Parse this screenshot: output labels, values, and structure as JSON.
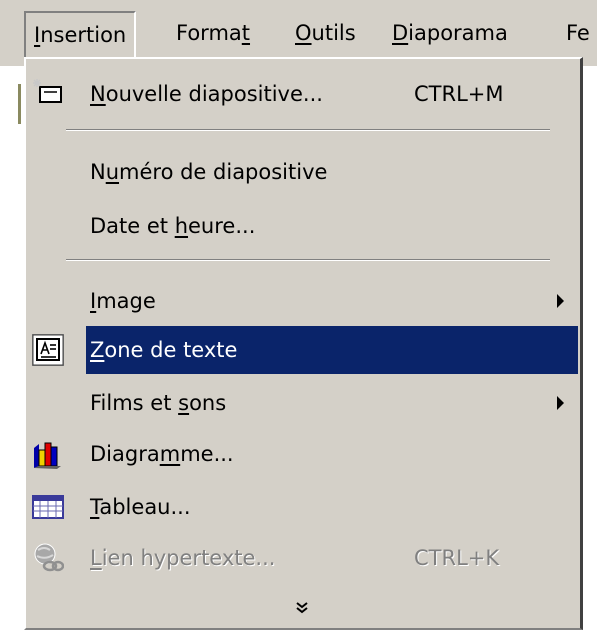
{
  "menubar": {
    "items": [
      {
        "pre": "",
        "u": "I",
        "post": "nsertion"
      },
      {
        "pre": "Forma",
        "u": "t",
        "post": ""
      },
      {
        "pre": "",
        "u": "O",
        "post": "utils"
      },
      {
        "pre": "",
        "u": "D",
        "post": "iaporama"
      },
      {
        "pre": "Fe",
        "u": "",
        "post": ""
      }
    ]
  },
  "menu": {
    "items": [
      {
        "pre": "",
        "u": "N",
        "post": "ouvelle diapositive...",
        "shortcut": "CTRL+M",
        "icon": "new-slide-icon"
      },
      {
        "pre": "N",
        "u": "u",
        "post": "méro de diapositive",
        "shortcut": ""
      },
      {
        "pre": "Date et ",
        "u": "h",
        "post": "eure...",
        "shortcut": ""
      },
      {
        "pre": "",
        "u": "I",
        "post": "mage",
        "submenu": true
      },
      {
        "pre": "",
        "u": "Z",
        "post": "one de texte",
        "icon": "text-box-icon",
        "highlighted": true
      },
      {
        "pre": "Films et ",
        "u": "s",
        "post": "ons",
        "submenu": true
      },
      {
        "pre": "Diagra",
        "u": "m",
        "post": "me...",
        "icon": "chart-icon"
      },
      {
        "pre": "",
        "u": "T",
        "post": "ableau...",
        "icon": "table-icon"
      },
      {
        "pre": "",
        "u": "L",
        "post": "ien hypertexte...",
        "shortcut": "CTRL+K",
        "icon": "hyperlink-icon",
        "disabled": true
      }
    ],
    "expand_glyph": "⌵",
    "highlight_color": "#0a246a",
    "menu_bg": "#d4d0c8"
  }
}
